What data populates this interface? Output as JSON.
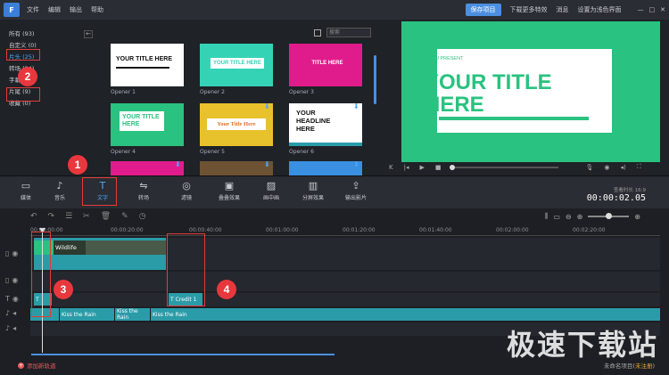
{
  "menubar": {
    "logo": "F",
    "menu": [
      "文件",
      "编辑",
      "输出",
      "帮助"
    ],
    "right": [
      "保存项目",
      "下载更多特效",
      "消息",
      "设置为浅色界面"
    ]
  },
  "categories": [
    {
      "label": "所有 (93)"
    },
    {
      "label": "自定义 (0)"
    },
    {
      "label": "片头 (25)"
    },
    {
      "label": "转场 (24)"
    },
    {
      "label": "字幕 (26)"
    },
    {
      "label": "片尾 (9)"
    },
    {
      "label": "收藏 (0)"
    }
  ],
  "library": {
    "search_placeholder": "搜索",
    "tiles": [
      {
        "label": "Opener 1",
        "text": "YOUR TITLE HERE"
      },
      {
        "label": "Opener 2",
        "text": "YOUR TITLE HERE"
      },
      {
        "label": "Opener 3",
        "text": "TITLE HERE"
      },
      {
        "label": "Opener 4",
        "text": "YOUR TITLE HERE"
      },
      {
        "label": "Opener 5",
        "text": "Your Title Here"
      },
      {
        "label": "Opener 6",
        "text": "YOUR HEADLINE HERE"
      }
    ]
  },
  "preview": {
    "small_text": "YOU PRESENT",
    "title": "YOUR TITLE HERE"
  },
  "toolbar": {
    "tools": [
      "媒体",
      "音乐",
      "文字",
      "转场",
      "滤镜",
      "叠叠效果",
      "画中画",
      "分屏效果",
      "输出影片"
    ],
    "timecode_label": "查看时长 16:9",
    "timecode": "00:00:02.05"
  },
  "timeline": {
    "ruler": [
      "00:00:00:00",
      "00:00:20:00",
      "00:00:40:00",
      "00:01:00:00",
      "00:01:20:00",
      "00:01:40:00",
      "00:02:00:00",
      "00:02:20:00"
    ],
    "video_clip": "Wildlife",
    "title_clip": "Credit 1",
    "audio_clips": [
      "Kiss the Rain",
      "Kiss the Rain",
      "Kiss the Rain"
    ],
    "add_track": "添加新轨道",
    "project": "未命名项目",
    "unsaved": "(未注册)"
  },
  "annotations": [
    "1",
    "2",
    "3",
    "4"
  ],
  "watermark": "极速下载站"
}
